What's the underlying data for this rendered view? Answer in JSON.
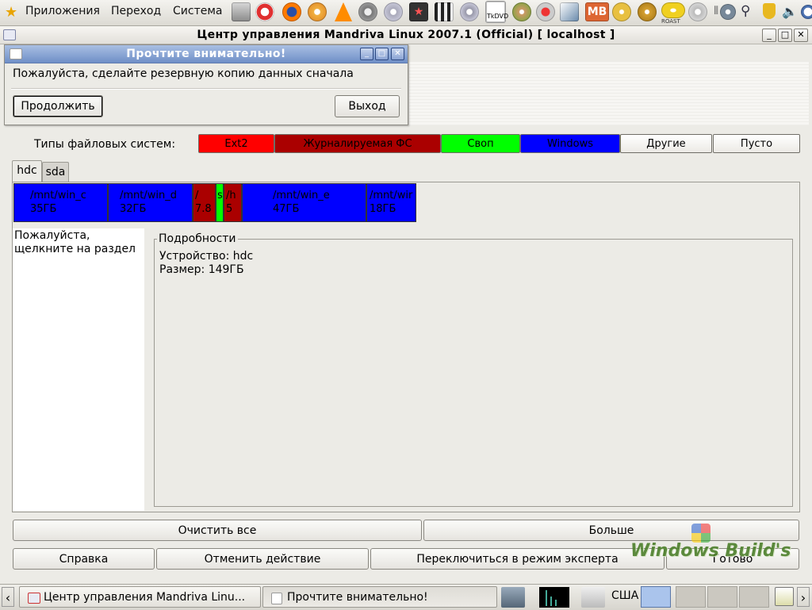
{
  "top_panel": {
    "menus": [
      "Приложения",
      "Переход",
      "Система"
    ],
    "launcher_icons": [
      "star-icon",
      "disk-drive-icon",
      "lifebuoy-icon",
      "firefox-icon",
      "cd-player-icon",
      "vlc-cone-icon",
      "film-reel-icon",
      "cd-burner-icon",
      "video-star-icon",
      "clapperboard-icon",
      "cd-icon",
      "tkdvd-icon",
      "guitar-icon",
      "webcam-icon",
      "rocket-icon",
      "mb-icon",
      "dvd-icon",
      "cd-gold-icon",
      "roast-icon",
      "disc-icon",
      "tools-icon",
      "search-icon",
      "shield-icon",
      "volume-icon",
      "clock-icon"
    ],
    "tkdvd_label": "TkDVD",
    "roast_label": "ROAST",
    "mb_label": "МВ"
  },
  "main_window": {
    "title": "Центр управления Mandriva Linux 2007.1 (Official) [ localhost ]",
    "controls": {
      "minimize": "_",
      "maximize": "□",
      "close": "✕"
    },
    "fs_types_label": "Типы файловых систем:",
    "fs_types": [
      {
        "label": "Ext2",
        "color": "#ff0000"
      },
      {
        "label": "Журналируемая ФС",
        "color": "#aa0000"
      },
      {
        "label": "Своп",
        "color": "#00ff00"
      },
      {
        "label": "Windows",
        "color": "#0000ff"
      },
      {
        "label": "Другие",
        "color": "#ffffff"
      },
      {
        "label": "Пусто",
        "color": "#ffffff"
      }
    ],
    "tabs": [
      "hdc",
      "sda"
    ],
    "partitions": [
      {
        "mount": "/mnt/win_c",
        "size": "35ГБ",
        "color": "#0000ff"
      },
      {
        "mount": "/mnt/win_d",
        "size": "32ГБ",
        "color": "#0000ff"
      },
      {
        "mount": "/",
        "size": "7.8",
        "color": "#aa0000"
      },
      {
        "mount": "s",
        "size": "",
        "color": "#00ff00"
      },
      {
        "mount": "/h",
        "size": "5",
        "color": "#aa0000"
      },
      {
        "mount": "/mnt/win_e",
        "size": "47ГБ",
        "color": "#0000ff"
      },
      {
        "mount": "/mnt/wir",
        "size": "18ГБ",
        "color": "#0000ff"
      }
    ],
    "hint": "Пожалуйста, щелкните на раздел",
    "details": {
      "legend": "Подробности",
      "device": "Устройство: hdc",
      "size": "Размер: 149ГБ"
    },
    "buttons": {
      "clear_all": "Очистить все",
      "more": "Больше",
      "help": "Справка",
      "undo": "Отменить действие",
      "expert": "Переключиться в режим эксперта",
      "done": "Готово"
    }
  },
  "dialog": {
    "title": "Прочтите внимательно!",
    "message": "Пожалуйста, сделайте резервную копию данных сначала",
    "continue": "Продолжить",
    "exit": "Выход"
  },
  "taskbar": {
    "left_arrow": "‹",
    "right_arrow": "›",
    "tasks": [
      {
        "label": "Центр управления Mandriva Linu..."
      },
      {
        "label": "Прочтите внимательно!"
      }
    ],
    "tray_text": "США"
  },
  "watermark": "Windows Build's"
}
